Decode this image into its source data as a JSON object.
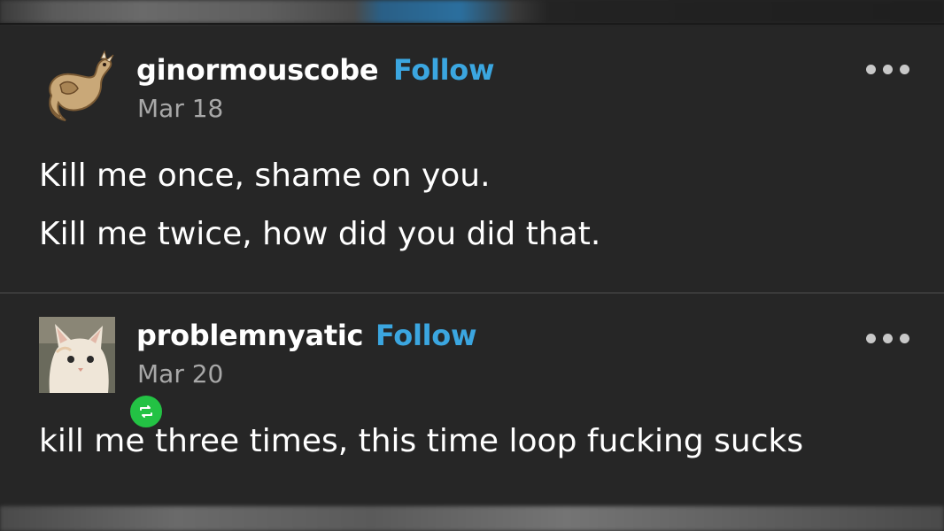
{
  "posts": [
    {
      "username": "ginormouscobe",
      "follow_label": "Follow",
      "date": "Mar 18",
      "lines": [
        "Kill me once, shame on you.",
        "Kill me twice, how did you did that."
      ],
      "avatar_icon": "dragon-avatar-icon",
      "menu_icon": "more-options-icon"
    },
    {
      "username": "problemnyatic",
      "follow_label": "Follow",
      "date": "Mar 20",
      "lines": [
        "kill me three times, this time loop fucking sucks"
      ],
      "avatar_icon": "cat-avatar-icon",
      "badge_icon": "reblog-icon",
      "menu_icon": "more-options-icon"
    }
  ],
  "colors": {
    "background": "#262626",
    "follow": "#3ba6e0",
    "date": "#a8a8a8",
    "reblog_badge": "#23c244"
  }
}
